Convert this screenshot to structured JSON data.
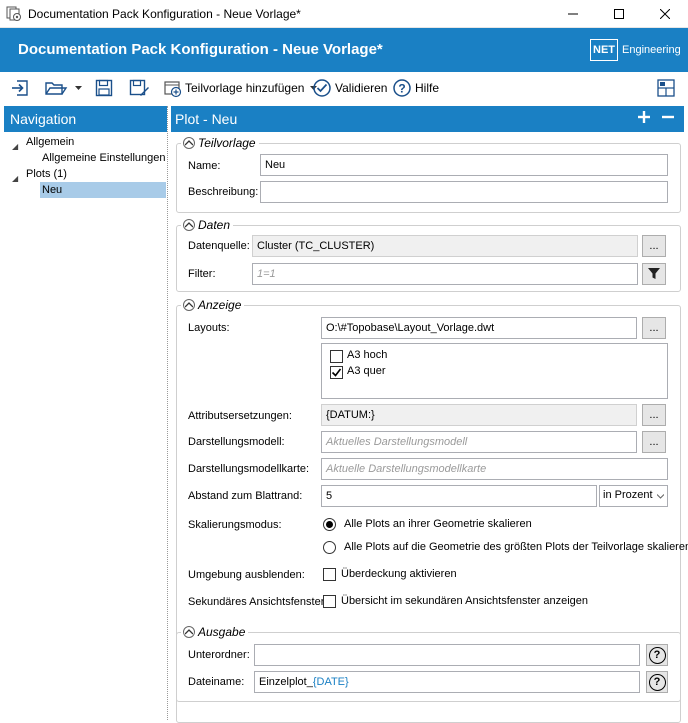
{
  "window": {
    "title": "Documentation Pack Konfiguration - Neue Vorlage*"
  },
  "header": {
    "title": "Documentation Pack Konfiguration - Neue Vorlage*",
    "logo_net": "NET",
    "logo_text": "Engineering"
  },
  "toolbar": {
    "add_subtemplate_label": "Teilvorlage hinzufügen",
    "validate_label": "Validieren",
    "help_label": "Hilfe"
  },
  "navigation": {
    "title": "Navigation",
    "tree": {
      "allgemein": "Allgemein",
      "allgemeine_einstellungen": "Allgemeine Einstellungen",
      "plots": "Plots (1)",
      "neu": "Neu"
    }
  },
  "panel": {
    "title": "Plot  -  Neu",
    "add": "+",
    "remove": "−"
  },
  "teilvorlage": {
    "title": "Teilvorlage",
    "name_label": "Name:",
    "name_value": "Neu",
    "beschreibung_label": "Beschreibung:",
    "beschreibung_value": ""
  },
  "daten": {
    "title": "Daten",
    "datenquelle_label": "Datenquelle:",
    "datenquelle_value": "Cluster (TC_CLUSTER)",
    "filter_label": "Filter:",
    "filter_placeholder": "1=1",
    "browse": "..."
  },
  "anzeige": {
    "title": "Anzeige",
    "layouts_label": "Layouts:",
    "layouts_value": "O:\\#Topobase\\Layout_Vorlage.dwt",
    "layout_options": [
      {
        "label": "A3 hoch",
        "checked": false
      },
      {
        "label": "A3 quer",
        "checked": true
      }
    ],
    "attr_label": "Attributsersetzungen:",
    "attr_value": "{DATUM:}",
    "dmodell_label": "Darstellungsmodell:",
    "dmodell_placeholder": "Aktuelles Darstellungsmodell",
    "dkarte_label": "Darstellungsmodellkarte:",
    "dkarte_placeholder": "Aktuelle Darstellungsmodellkarte",
    "abstand_label": "Abstand zum Blattrand:",
    "abstand_value": "5",
    "abstand_unit": "in Prozent",
    "skal_label": "Skalierungsmodus:",
    "skal_option1": "Alle Plots an ihrer Geometrie skalieren",
    "skal_option2": "Alle Plots auf die Geometrie des größten Plots der Teilvorlage skalieren",
    "umgebung_label": "Umgebung ausblenden:",
    "umgebung_check": "Überdeckung aktivieren",
    "sek_label": "Sekundäres Ansichtsfenster:",
    "sek_check": "Übersicht im sekundären Ansichtsfenster anzeigen"
  },
  "ausgabe": {
    "title": "Ausgabe",
    "unterordner_label": "Unterordner:",
    "unterordner_value": "",
    "dateiname_label": "Dateiname:",
    "dateiname_prefix": "Einzelplot_",
    "dateiname_token": "{DATE}",
    "help": "?"
  },
  "colors": {
    "accent": "#1a80c4",
    "selection": "#a8cbe8",
    "token": "#1a80c4"
  }
}
